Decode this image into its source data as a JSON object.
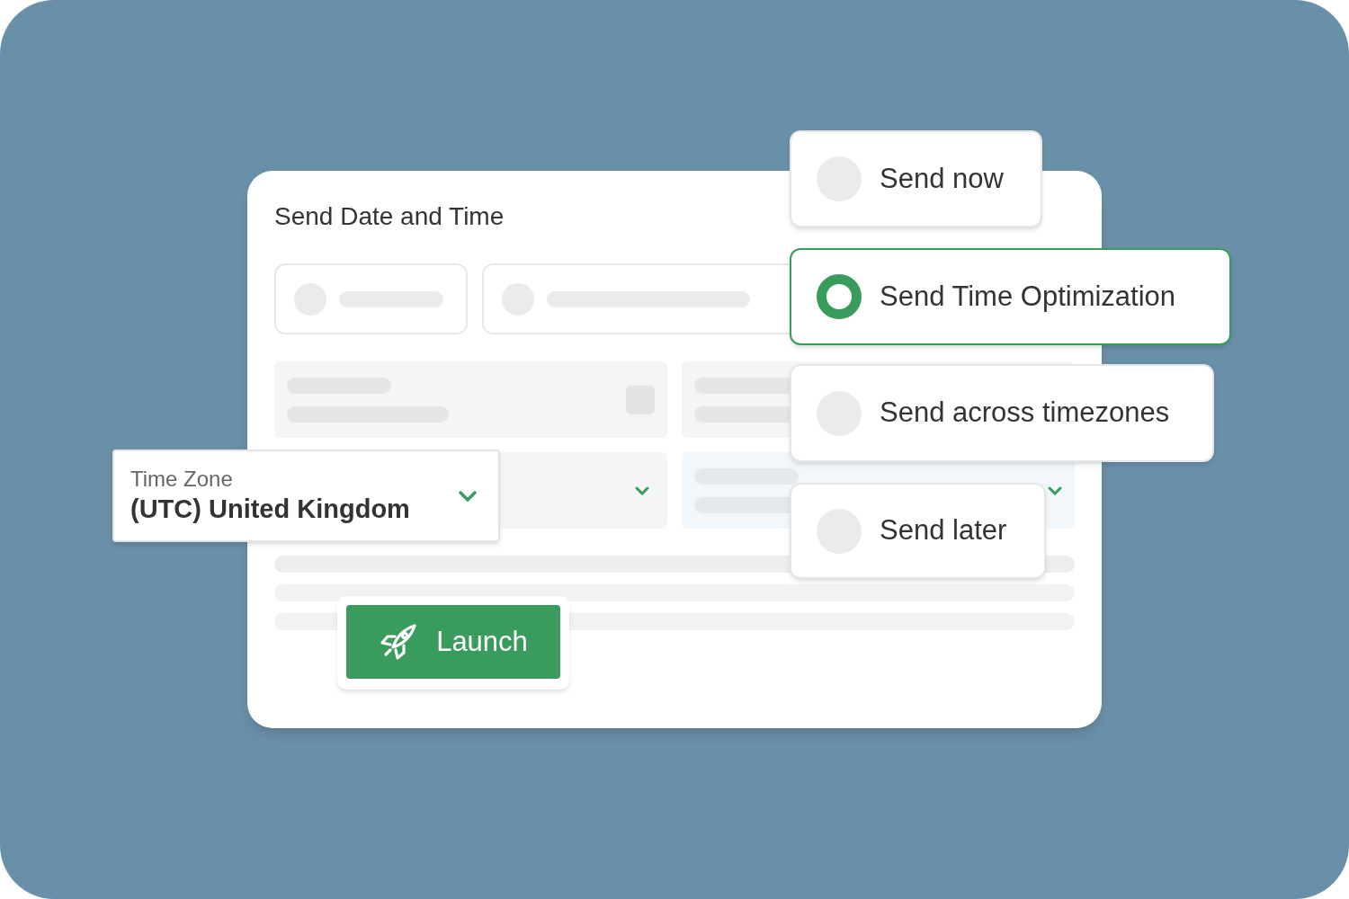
{
  "card": {
    "title": "Send Date and Time"
  },
  "time_zone": {
    "label": "Time Zone",
    "value": "(UTC) United Kingdom"
  },
  "options": [
    {
      "label": "Send now",
      "selected": false
    },
    {
      "label": "Send Time Optimization",
      "selected": true
    },
    {
      "label": "Send across timezones",
      "selected": false
    },
    {
      "label": "Send later",
      "selected": false
    }
  ],
  "launch_button": {
    "label": "Launch"
  }
}
